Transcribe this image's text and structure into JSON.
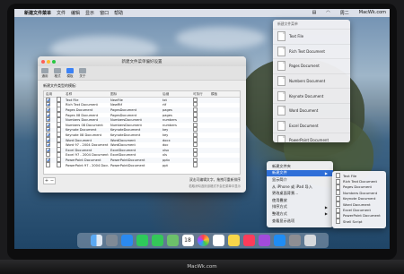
{
  "menubar": {
    "app_name": "新建文件菜单",
    "items": [
      "文件",
      "编辑",
      "显示",
      "窗口",
      "帮助"
    ],
    "status": [
      "周二",
      "MacWk.com"
    ]
  },
  "settings_window": {
    "title": "新建文件菜单偏好设置",
    "toolbar": [
      "通用",
      "格式",
      "模板",
      "关于"
    ],
    "section_label": "新建文件类型的模板:",
    "columns": [
      "启用",
      "名称",
      "图标",
      "后缀",
      "可执行",
      "模板"
    ],
    "rows": [
      {
        "on": true,
        "name": "Text File",
        "icon": "NewFile",
        "ext": "txt"
      },
      {
        "on": true,
        "name": "Rich Text Document",
        "icon": "NewRtf",
        "ext": "rtf"
      },
      {
        "on": true,
        "name": "Pages Document",
        "icon": "PagesDocument",
        "ext": "pages"
      },
      {
        "on": true,
        "name": "Pages 08 Document",
        "icon": "PagesDocument",
        "ext": "pages"
      },
      {
        "on": true,
        "name": "Numbers Document",
        "icon": "NumbersDocument",
        "ext": "numbers"
      },
      {
        "on": true,
        "name": "Numbers 08 Document",
        "icon": "NumbersDocument",
        "ext": "numbers"
      },
      {
        "on": true,
        "name": "Keynote Document",
        "icon": "KeynoteDocument",
        "ext": "key"
      },
      {
        "on": true,
        "name": "Keynote 08 Document",
        "icon": "KeynoteDocument",
        "ext": "key"
      },
      {
        "on": true,
        "name": "Word Document",
        "icon": "WordDocument",
        "ext": "docx"
      },
      {
        "on": true,
        "name": "Word 97 - 2004 Document",
        "icon": "WordDocument",
        "ext": "doc"
      },
      {
        "on": true,
        "name": "Excel Document",
        "icon": "ExcelDocument",
        "ext": "xlsx"
      },
      {
        "on": false,
        "name": "Excel 97 - 2004 Document",
        "icon": "ExcelDocument",
        "ext": "xls"
      },
      {
        "on": true,
        "name": "PowerPoint Document",
        "icon": "PowerPointDocument",
        "ext": "pptx"
      },
      {
        "on": false,
        "name": "PowerPoint 97 - 2004 Document",
        "icon": "PowerPointDocument",
        "ext": "ppt"
      }
    ],
    "footer_note": "双击可编辑文字，拖拽可重新排序",
    "footer_sub": "若取消勾选则该格式不会在菜单中显示"
  },
  "dropdown": {
    "header": "新建文件菜单",
    "items": [
      "Text File",
      "Rich Text Document",
      "Pages Document",
      "Numbers Document",
      "Keynote Document",
      "Word Document",
      "Excel Document",
      "PowerPoint Document"
    ]
  },
  "context_menu": {
    "items": [
      "新建文件夹",
      "新建文件",
      "显示简介",
      "从 iPhone 或 iPad 导入",
      "更改桌面背景…",
      "使用叠放",
      "排序方式",
      "整理方式",
      "查看显示选项"
    ],
    "highlighted_index": 1
  },
  "submenu": {
    "items": [
      "Text File",
      "Rich Text Document",
      "Pages Document",
      "Numbers Document",
      "Keynote Document",
      "Word Document",
      "Excel Document",
      "PowerPoint Document",
      "Shell Script"
    ]
  },
  "dock": {
    "icons": [
      "finder-icon",
      "launchpad-icon",
      "safari-icon",
      "messages-icon",
      "facetime-icon",
      "maps-icon",
      "calendar-icon",
      "photos-icon",
      "reminders-icon",
      "notes-icon",
      "music-icon",
      "podcasts-icon",
      "appstore-icon",
      "settings-icon",
      "trash-icon"
    ],
    "calendar_day": "18"
  },
  "chin_label": "MacWk.com"
}
